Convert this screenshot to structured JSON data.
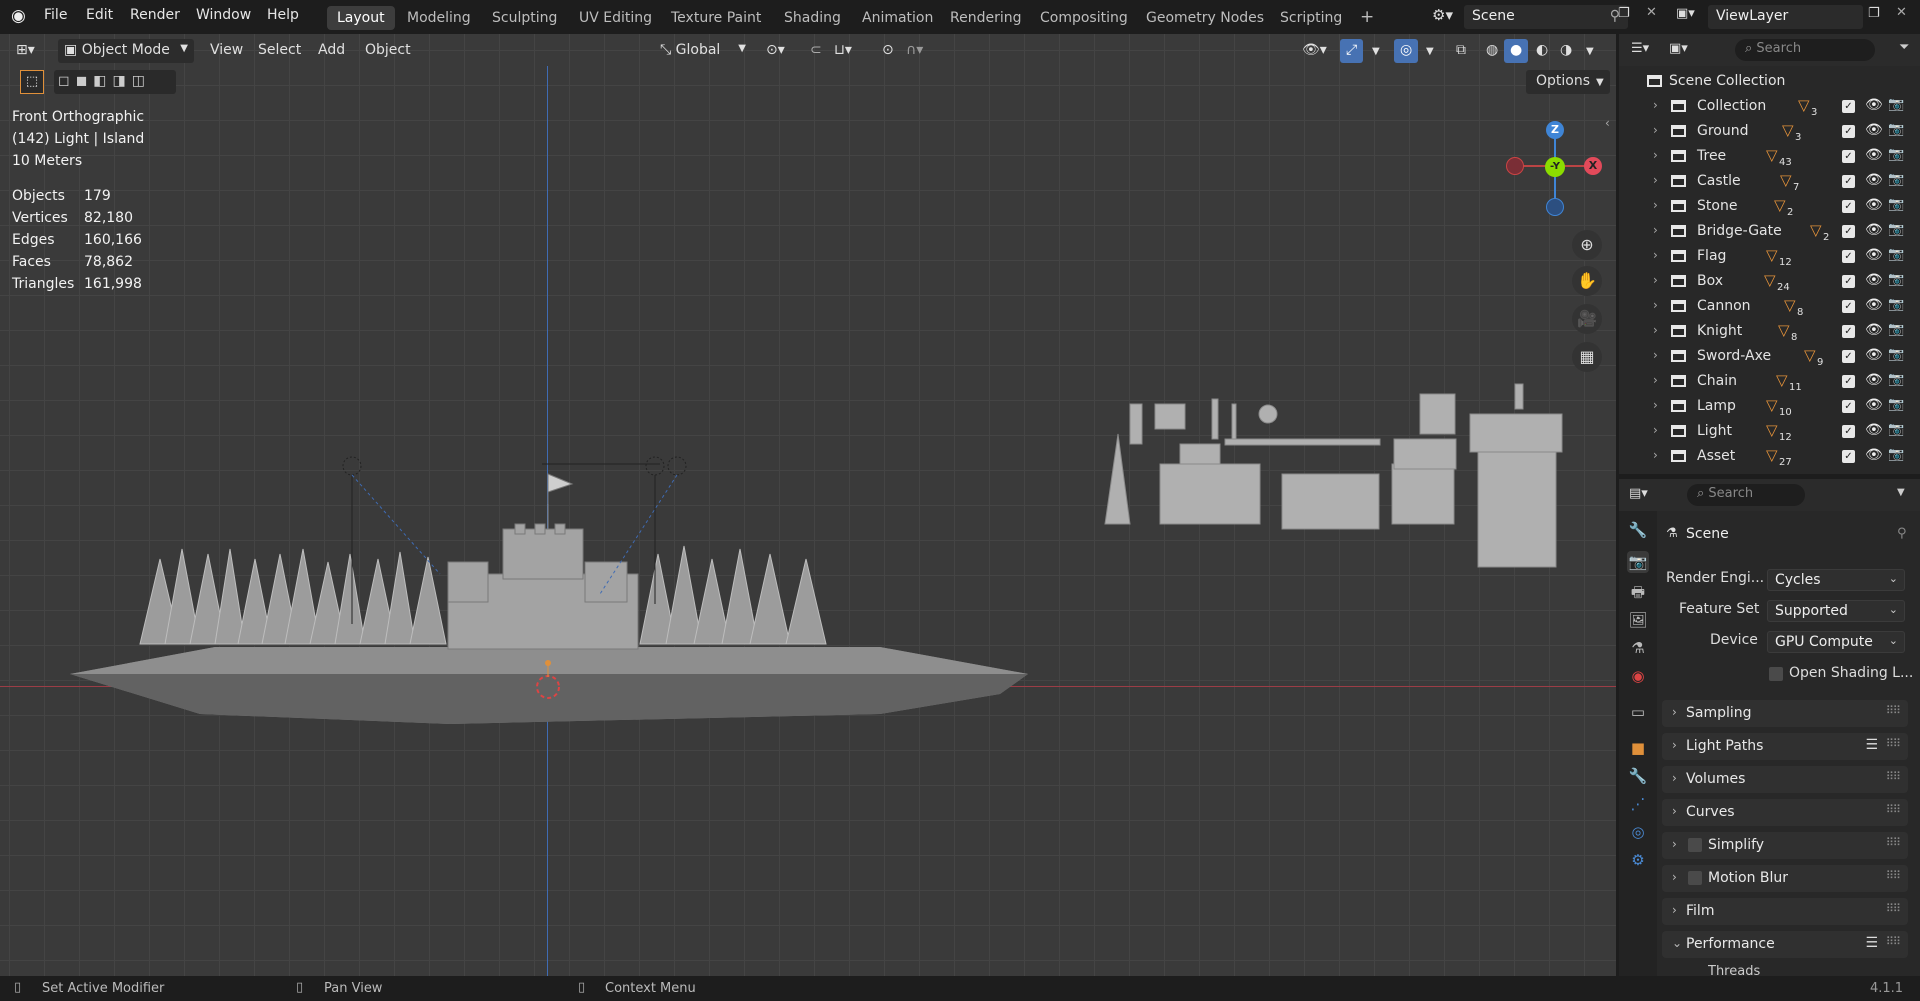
{
  "app": {
    "menus": [
      "File",
      "Edit",
      "Render",
      "Window",
      "Help"
    ],
    "workspaces": [
      "Layout",
      "Modeling",
      "Sculpting",
      "UV Editing",
      "Texture Paint",
      "Shading",
      "Animation",
      "Rendering",
      "Compositing",
      "Geometry Nodes",
      "Scripting"
    ],
    "active_workspace": "Layout",
    "add_workspace": "+",
    "scene_name": "Scene",
    "view_layer": "ViewLayer"
  },
  "viewport_header": {
    "mode": "Object Mode",
    "menus": [
      "View",
      "Select",
      "Add",
      "Object"
    ],
    "transform_orientation": "Global",
    "options_label": "Options"
  },
  "viewport_overlay": {
    "view_name": "Front Orthographic",
    "context": "(142) Light | Island",
    "scale": "10 Meters",
    "stats": [
      {
        "label": "Objects",
        "value": "179"
      },
      {
        "label": "Vertices",
        "value": "82,180"
      },
      {
        "label": "Edges",
        "value": "160,166"
      },
      {
        "label": "Faces",
        "value": "78,862"
      },
      {
        "label": "Triangles",
        "value": "161,998"
      }
    ],
    "gizmo": {
      "z": "Z",
      "y": "-Y",
      "x": "X"
    }
  },
  "outliner": {
    "search_placeholder": "Search",
    "root": "Scene Collection",
    "items": [
      {
        "name": "Collection",
        "count": "3"
      },
      {
        "name": "Ground",
        "count": "3"
      },
      {
        "name": "Tree",
        "count": "43"
      },
      {
        "name": "Castle",
        "count": "7"
      },
      {
        "name": "Stone",
        "count": "2"
      },
      {
        "name": "Bridge-Gate",
        "count": "2"
      },
      {
        "name": "Flag",
        "count": "12"
      },
      {
        "name": "Box",
        "count": "24"
      },
      {
        "name": "Cannon",
        "count": "8"
      },
      {
        "name": "Knight",
        "count": "8"
      },
      {
        "name": "Sword-Axe",
        "count": "9"
      },
      {
        "name": "Chain",
        "count": "11"
      },
      {
        "name": "Lamp",
        "count": "10"
      },
      {
        "name": "Light",
        "count": "12"
      },
      {
        "name": "Asset",
        "count": "27"
      }
    ]
  },
  "properties": {
    "search_placeholder": "Search",
    "context": "Scene",
    "render_engine_label": "Render Engi...",
    "render_engine": "Cycles",
    "feature_set_label": "Feature Set",
    "feature_set": "Supported",
    "device_label": "Device",
    "device": "GPU Compute",
    "osl_label": "Open Shading L...",
    "panels": [
      "Sampling",
      "Light Paths",
      "Volumes",
      "Curves",
      "Simplify",
      "Motion Blur",
      "Film",
      "Performance"
    ],
    "subpanel": "Threads"
  },
  "statusbar": {
    "left": "Set Active Modifier",
    "middle": "Pan View",
    "right": "Context Menu",
    "version": "4.1.1"
  },
  "colors": {
    "accent": "#4772b3",
    "orange": "#e0903a",
    "x_axis": "#e24a5a",
    "y_axis": "#8bdc00",
    "z_axis": "#3f85d6"
  }
}
